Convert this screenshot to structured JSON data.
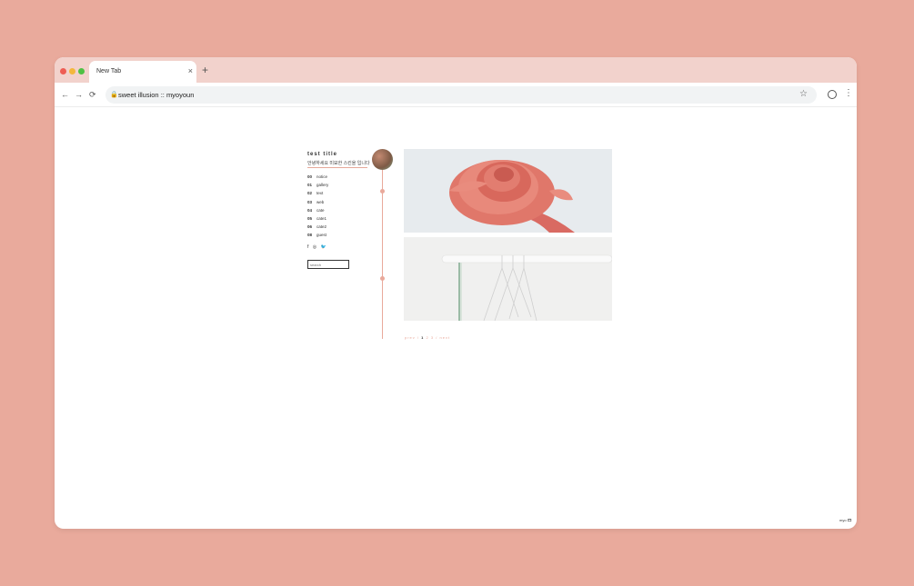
{
  "browser": {
    "tab_title": "New Tab",
    "tab_close_icon": "×",
    "new_tab_icon": "+",
    "back_icon": "←",
    "forward_icon": "→",
    "reload_icon": "⟳",
    "lock_icon": "🔒",
    "url": "sweet illusion :: myoyoun",
    "star_icon": "☆",
    "menu_icon": "⋮"
  },
  "blog": {
    "title": "test title",
    "subtitle": "안녕하세요 미묘한 스킨을 입니다",
    "nav": [
      {
        "num": "00",
        "label": "notice"
      },
      {
        "num": "01",
        "label": "gallery"
      },
      {
        "num": "02",
        "label": "text"
      },
      {
        "num": "03",
        "label": "web"
      },
      {
        "num": "04",
        "label": "cate"
      },
      {
        "num": "05",
        "label": "cate1"
      },
      {
        "num": "06",
        "label": "cate2"
      },
      {
        "num": "08",
        "label": "guest"
      }
    ],
    "social": {
      "facebook": "f",
      "instagram": "◎",
      "twitter": "🐦"
    },
    "search_placeholder": "search"
  },
  "pagination": {
    "prev": "prev",
    "sep": "/",
    "pages": [
      "1",
      "2",
      "3"
    ],
    "current": "1",
    "next": "next"
  },
  "footer_badge": "myo 🎞",
  "colors": {
    "background": "#e9aa9c",
    "tab_bar": "#f2d2cc",
    "accent": "#e9a99b"
  }
}
